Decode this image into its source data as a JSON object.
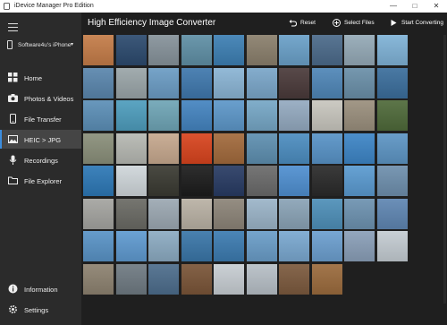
{
  "window": {
    "title": "iDevice Manager Pro Edition"
  },
  "sidebar": {
    "device_name": "Software4u's iPhone",
    "items": [
      {
        "label": "Home",
        "icon": "home-grid-icon"
      },
      {
        "label": "Photos & Videos",
        "icon": "camera-icon"
      },
      {
        "label": "File Transfer",
        "icon": "phone-icon"
      },
      {
        "label": "HEIC > JPG",
        "icon": "image-convert-icon",
        "active": true
      },
      {
        "label": "Recordings",
        "icon": "microphone-icon"
      },
      {
        "label": "File Explorer",
        "icon": "folder-icon"
      }
    ],
    "bottom_items": [
      {
        "label": "Information",
        "icon": "info-icon"
      },
      {
        "label": "Settings",
        "icon": "gear-icon"
      }
    ]
  },
  "header": {
    "title": "High Efficiency Image Converter",
    "reset_label": "Reset",
    "select_files_label": "Select Files",
    "start_converting_label": "Start Converting"
  },
  "accent_color": "#3c8dde",
  "thumbnails": [
    [
      "#c47c48",
      "#2c4a6e",
      "#86929a",
      "#5f8fa5",
      "#3d7fb3",
      "#8a7f6c",
      "#6aa0c8",
      "#4b6a8a",
      "#94a9b6",
      "#7fb2d6"
    ],
    [
      "#5a86ad",
      "#9aa5a8",
      "#6b9cc4",
      "#3f78ad",
      "#8ab4d4",
      "#7aa6c9",
      "#4a3a3a",
      "#4f86b7",
      "#6a8fa8",
      "#3b6e9c"
    ],
    [
      "#5c8fb7",
      "#4e9dbd",
      "#6fa5b6",
      "#4484c0",
      "#5d97c9",
      "#76a7c6",
      "#94aac0",
      "#c8c6be",
      "#9a8f7d",
      "#4f6a3a"
    ],
    [
      "#8a8f7a",
      "#b6b8b2",
      "#c6a88e",
      "#d8441e",
      "#a26a3c",
      "#5e8fb0",
      "#4c8dc0",
      "#5893c7",
      "#3d85c6",
      "#5d95c4"
    ],
    [
      "#2d78b6",
      "#cfd6da",
      "#3a3a32",
      "#1c1c1c",
      "#283b63",
      "#6a6a6a",
      "#4f8fd0",
      "#2a2a2a",
      "#5a9ad0",
      "#6e8fad"
    ],
    [
      "#a4a4a0",
      "#6a6a64",
      "#9ca8b2",
      "#b9b1a4",
      "#8c8478",
      "#9bb4c8",
      "#8aa3b6",
      "#4e8fb8",
      "#6d92b0",
      "#5f86b2"
    ],
    [
      "#5993c6",
      "#5f9ad0",
      "#8cabc2",
      "#3a76a8",
      "#3c7bb0",
      "#6a9dc8",
      "#7aa8d0",
      "#6c9fcf",
      "#8a9fb8",
      "#c4ccd2"
    ],
    [
      "#8d8270",
      "#6f7a82",
      "#4d6d8c",
      "#7a5538",
      "#c7cdd2",
      "#b7bfc6",
      "#7c5a3e",
      "#9b6b3d"
    ]
  ]
}
